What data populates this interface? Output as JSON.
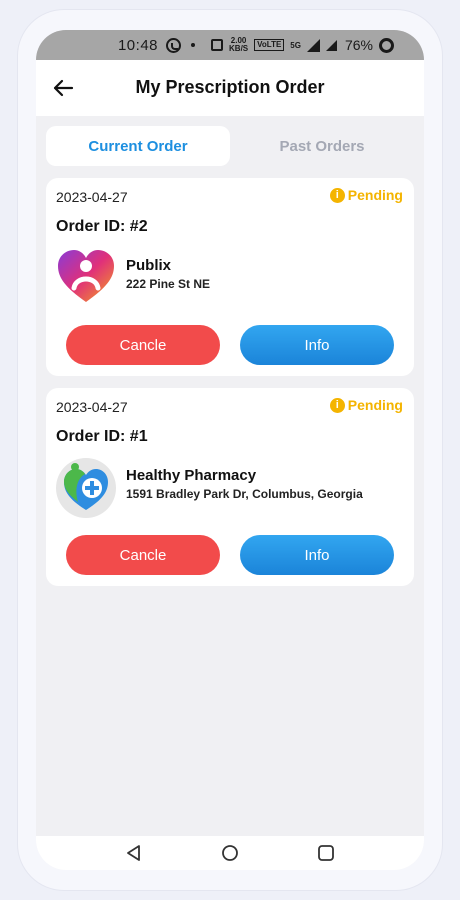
{
  "status_bar": {
    "time": "10:48",
    "speed_value": "2.00",
    "speed_unit": "KB/S",
    "volte": "VoLTE",
    "network": "5G",
    "battery": "76%"
  },
  "header": {
    "title": "My Prescription Order",
    "back_icon": "arrow-left-icon"
  },
  "tabs": [
    {
      "label": "Current Order",
      "active": true
    },
    {
      "label": "Past Orders",
      "active": false
    }
  ],
  "orders": [
    {
      "date": "2023-04-27",
      "status": "Pending",
      "order_id": "Order ID: #2",
      "pharmacy_name": "Publix",
      "pharmacy_address": "222 Pine St NE",
      "logo": "heart-person-logo",
      "cancel_label": "Cancle",
      "info_label": "Info"
    },
    {
      "date": "2023-04-27",
      "status": "Pending",
      "order_id": "Order ID: #1",
      "pharmacy_name": "Healthy Pharmacy",
      "pharmacy_address": "1591 Bradley Park Dr, Columbus, Georgia",
      "logo": "heart-cross-logo",
      "cancel_label": "Cancle",
      "info_label": "Info"
    }
  ],
  "colors": {
    "accent": "#1d8fe0",
    "pending": "#f4b400",
    "cancel": "#f24b4b",
    "info": "#1b84d9"
  },
  "nav": [
    "back-triangle-icon",
    "home-circle-icon",
    "recents-square-icon"
  ]
}
